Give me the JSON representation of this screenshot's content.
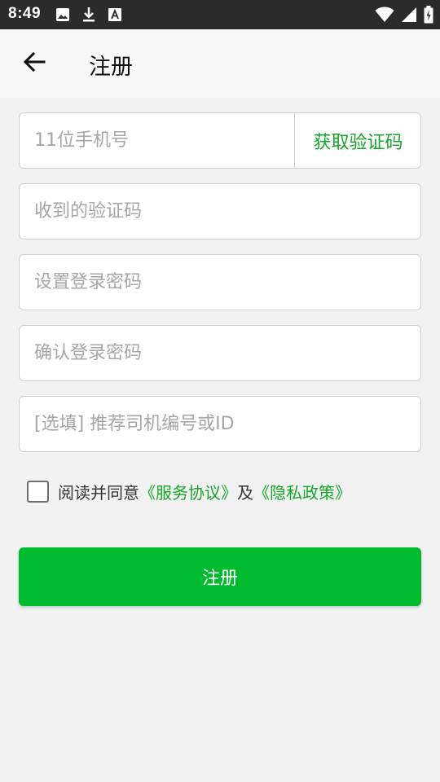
{
  "status_bar": {
    "time": "8:49",
    "left_icons": [
      "image-icon",
      "download-icon",
      "font-icon"
    ],
    "right_icons": [
      "wifi-icon",
      "cell-signal-icon",
      "battery-icon"
    ]
  },
  "header": {
    "back_icon": "arrow-left-icon",
    "title": "注册"
  },
  "form": {
    "phone": {
      "value": "",
      "placeholder": "11位手机号"
    },
    "get_code_label": "获取验证码",
    "sms_code": {
      "value": "",
      "placeholder": "收到的验证码"
    },
    "password": {
      "value": "",
      "placeholder": "设置登录密码"
    },
    "confirm_password": {
      "value": "",
      "placeholder": "确认登录密码"
    },
    "referrer": {
      "value": "",
      "placeholder": "[选填] 推荐司机编号或ID"
    }
  },
  "agreement": {
    "checked": false,
    "prefix": "阅读并同意",
    "service_link": "《服务协议》",
    "and": "及",
    "privacy_link": "《隐私政策》"
  },
  "submit_label": "注册",
  "colors": {
    "accent": "#00bb2d",
    "link": "#17a62a",
    "status_bar": "#2b2b2b",
    "background": "#f2f2f2"
  }
}
